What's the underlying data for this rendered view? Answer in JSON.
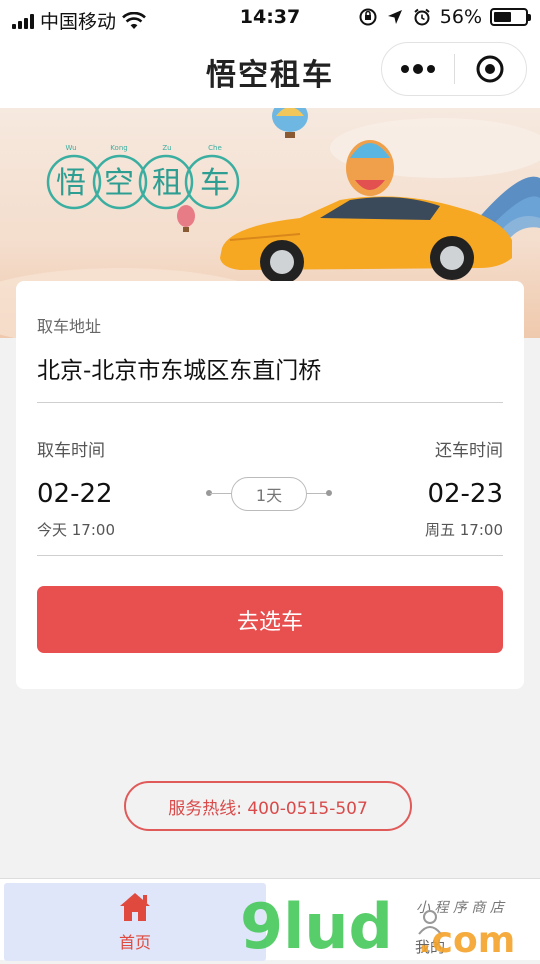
{
  "status_bar": {
    "carrier": "中国移动",
    "time": "14:37",
    "battery_percent": "56%",
    "battery_level": 0.56
  },
  "nav": {
    "title": "悟空租车"
  },
  "banner": {
    "logo_text": [
      "悟",
      "空",
      "租",
      "车"
    ],
    "pinyin": [
      "Wu",
      "Kong",
      "Zu",
      "Che"
    ]
  },
  "card": {
    "pickup_label": "取车地址",
    "pickup_address": "北京-北京市东城区东直门桥",
    "pickup_time_label": "取车时间",
    "return_time_label": "还车时间",
    "pickup_date": "02-22",
    "return_date": "02-23",
    "pickup_sub": "今天 17:00",
    "return_sub": "周五 17:00",
    "duration": "1天",
    "go_button": "去选车"
  },
  "hotline": "服务热线: 400-0515-507",
  "tabbar": {
    "home_label": "首页",
    "mine_label": "我的"
  },
  "watermark": {
    "brand": "9lud.com",
    "tagline": "小程序商店"
  },
  "colors": {
    "accent": "#e84f4f",
    "home_tab_bg": "#dfe6fa",
    "hotline": "#d94a4a"
  }
}
